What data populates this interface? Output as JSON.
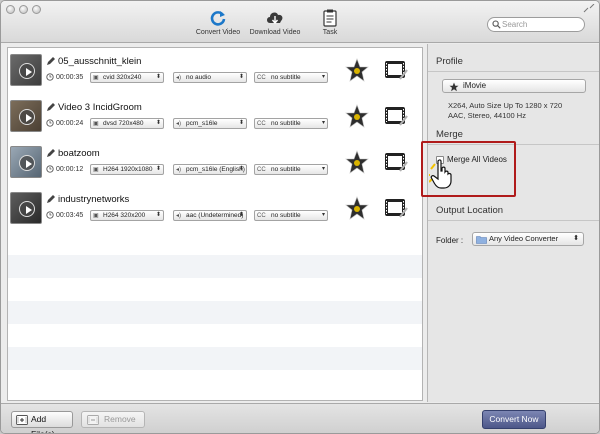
{
  "toolbar": {
    "convert_video": "Convert Video",
    "download_video": "Download Video",
    "task": "Task",
    "search_placeholder": "Search"
  },
  "videos": [
    {
      "title": "05_ausschnitt_klein",
      "duration": "00:00:35",
      "video": "cvid 320x240",
      "audio": "no audio",
      "subtitle": "no subtitle"
    },
    {
      "title": "Video 3 IncidGroom",
      "duration": "00:00:24",
      "video": "dvsd 720x480",
      "audio": "pcm_s16le",
      "subtitle": "no subtitle"
    },
    {
      "title": "boatzoom",
      "duration": "00:00:12",
      "video": "H264 1920x1080",
      "audio": "pcm_s16le (English)",
      "subtitle": "no subtitle"
    },
    {
      "title": "industrynetworks",
      "duration": "00:03:45",
      "video": "H264 320x200",
      "audio": "aac (Undetermined)",
      "subtitle": "no subtitle"
    }
  ],
  "icons": {
    "star": "imovie-star-icon",
    "film": "video-edit-icon"
  },
  "side": {
    "profile_title": "Profile",
    "profile_value": "iMovie",
    "profile_desc_line1": "X264, Auto Size Up To 1280 x 720",
    "profile_desc_line2": "AAC, Stereo, 44100 Hz",
    "merge_title": "Merge",
    "merge_label": "Merge All Videos",
    "output_title": "Output Location",
    "folder_label": "Folder :",
    "folder_value": "Any Video Converter"
  },
  "bottom": {
    "add_files": "Add File(s)",
    "remove": "Remove",
    "convert_now": "Convert Now"
  },
  "colors": {
    "accent": "#4d5789",
    "highlight": "#b01b1b"
  }
}
